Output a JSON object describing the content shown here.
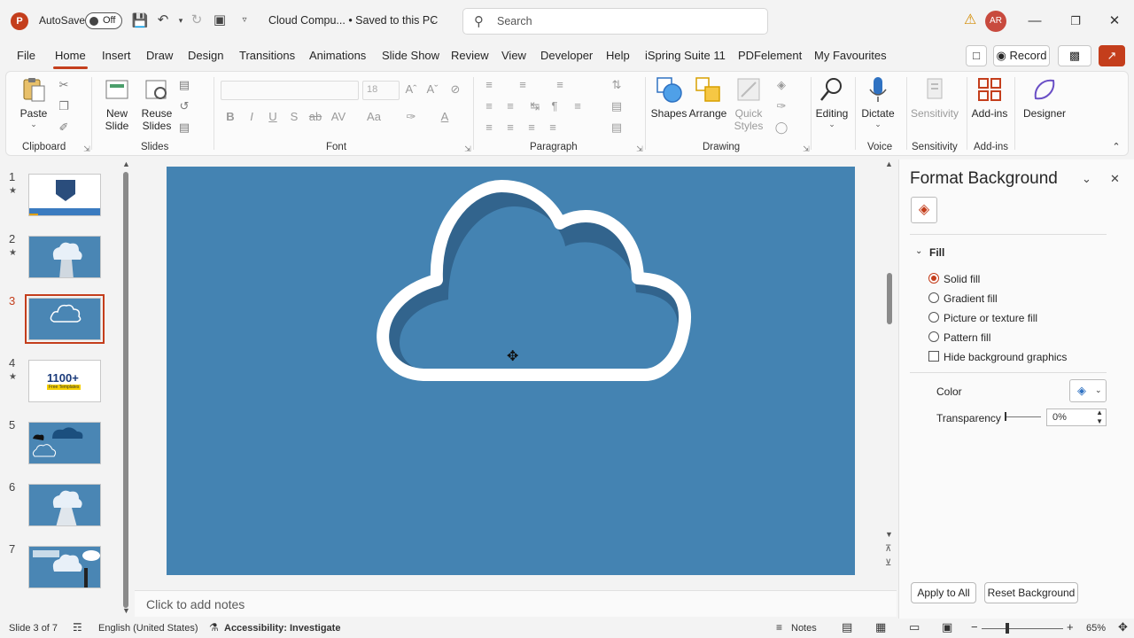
{
  "app": {
    "autosave_label": "AutoSave",
    "autosave_state": "Off",
    "doc_title": "Cloud Compu... • Saved to this PC",
    "search_placeholder": "Search",
    "avatar_initials": "AR"
  },
  "menu": {
    "tabs": [
      "File",
      "Home",
      "Insert",
      "Draw",
      "Design",
      "Transitions",
      "Animations",
      "Slide Show",
      "Review",
      "View",
      "Developer",
      "Help",
      "iSpring Suite 11",
      "PDFelement",
      "My Favourites"
    ],
    "record_label": "Record"
  },
  "ribbon": {
    "clipboard": {
      "paste": "Paste",
      "group": "Clipboard"
    },
    "slides": {
      "new_slide": "New Slide",
      "reuse_slides": "Reuse Slides",
      "group": "Slides"
    },
    "font": {
      "size": "18",
      "group": "Font"
    },
    "paragraph": {
      "group": "Paragraph"
    },
    "drawing": {
      "shapes": "Shapes",
      "arrange": "Arrange",
      "quick_styles": "Quick Styles",
      "group": "Drawing"
    },
    "editing": {
      "label": "Editing"
    },
    "voice": {
      "dictate": "Dictate",
      "group": "Voice"
    },
    "sensitivity": {
      "label": "Sensitivity",
      "group": "Sensitivity"
    },
    "addins": {
      "label": "Add-ins",
      "group": "Add-ins"
    },
    "designer": {
      "label": "Designer"
    }
  },
  "thumbnails": [
    {
      "num": "1",
      "star": true
    },
    {
      "num": "2",
      "star": true
    },
    {
      "num": "3",
      "star": false,
      "selected": true
    },
    {
      "num": "4",
      "star": true,
      "text": "1100+",
      "subtext": "Free Templates"
    },
    {
      "num": "5",
      "star": false
    },
    {
      "num": "6",
      "star": false
    },
    {
      "num": "7",
      "star": false
    }
  ],
  "notes_placeholder": "Click to add notes",
  "format_pane": {
    "title": "Format Background",
    "section": "Fill",
    "options": [
      "Solid fill",
      "Gradient fill",
      "Picture or texture fill",
      "Pattern fill"
    ],
    "selected_option": "Solid fill",
    "hide_bg_graphics": "Hide background graphics",
    "color_label": "Color",
    "transparency_label": "Transparency",
    "transparency_value": "0%",
    "apply_all": "Apply to All",
    "reset_bg": "Reset Background"
  },
  "statusbar": {
    "slide_info": "Slide 3 of 7",
    "language": "English (United States)",
    "accessibility": "Accessibility: Investigate",
    "notes": "Notes",
    "zoom": "65%"
  },
  "colors": {
    "accent": "#c43e1c",
    "slide_bg": "#4483b2",
    "home_tab_underline": "#c43e1c"
  }
}
